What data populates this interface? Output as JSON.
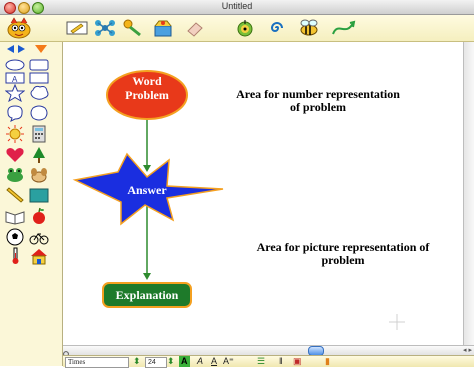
{
  "window": {
    "title": "Untitled"
  },
  "toolbar": {
    "tools": [
      "pencil-icon",
      "network-icon",
      "link-icon",
      "box-icon",
      "eraser-icon",
      "target-icon",
      "spiral-icon",
      "bee-icon",
      "curve-arrow-icon"
    ]
  },
  "palette": {
    "shapes": [
      "oval-shape",
      "rectangle-shape",
      "label-shape",
      "star-shape",
      "cloud-shape",
      "thought-shape",
      "burst-shape",
      "sun-icon",
      "calculator-icon",
      "heart-icon",
      "tree-icon",
      "frog-icon",
      "dog-icon",
      "pencil-icon",
      "chalkboard-icon",
      "book-icon",
      "apple-icon",
      "soccer-ball-icon",
      "bicycle-icon",
      "thermometer-icon",
      "house-icon"
    ]
  },
  "diagram": {
    "nodes": [
      {
        "id": "word-problem",
        "label_line1": "Word",
        "label_line2": "Problem",
        "shape": "ellipse",
        "fill": "#e8391a"
      },
      {
        "id": "answer",
        "label": "Answer",
        "shape": "star",
        "fill": "#1a2ee0"
      },
      {
        "id": "explanation",
        "label": "Explanation",
        "shape": "rounded-rect",
        "fill": "#1e7a2a"
      }
    ],
    "notes": [
      {
        "id": "number-area",
        "line1": "Area for number representation",
        "line2": "of problem"
      },
      {
        "id": "picture-area",
        "line1": "Area for picture representation of",
        "line2": "problem"
      }
    ],
    "link_color": "#2e8b2e"
  },
  "formatbar": {
    "font": "Times",
    "size": "24"
  }
}
